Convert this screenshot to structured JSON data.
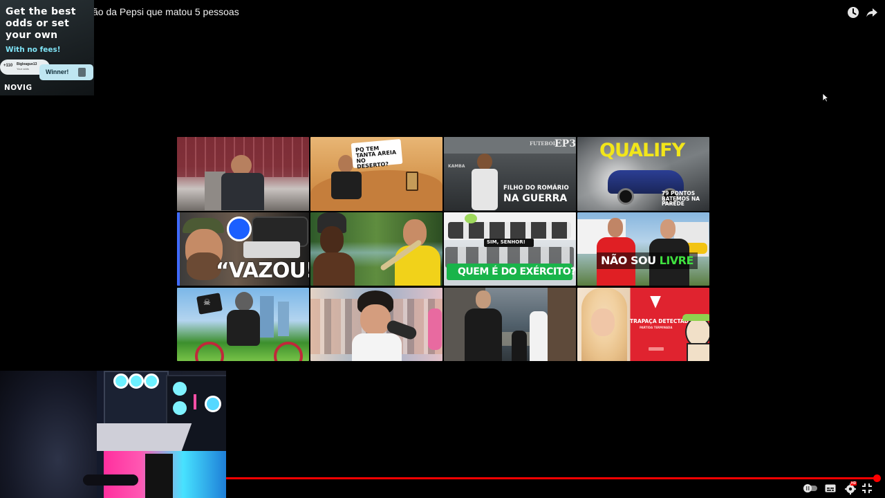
{
  "player": {
    "title": "ão da Pepsi que matou 5 pessoas",
    "icons": [
      "clock-icon",
      "share-icon"
    ],
    "progress_fraction": 1.0,
    "accent_color": "#ff0000"
  },
  "ad": {
    "headline": "Get the best odds or set your own",
    "subline": "With no fees!",
    "user_number": "+110",
    "user_name": "Bigleague13",
    "user_sub": "Your odds",
    "winner_label": "Winner!",
    "brand": "NOVIG"
  },
  "end_screen": {
    "thumbnails": [
      {
        "id": 1,
        "caption": ""
      },
      {
        "id": 2,
        "caption": "PQ TEM TANTA AREIA NO DESERTO?"
      },
      {
        "id": 3,
        "caption_top": "FUTEBOL",
        "caption_ep": "EP3",
        "caption_line1": "FILHO DO ROMÁRIO",
        "caption_line2": "NA GUERRA",
        "sign": "KAMBA"
      },
      {
        "id": 4,
        "caption": "QUALIFY",
        "sub_caption": "79 PONTOS BATEMOS NA PAREDE"
      },
      {
        "id": 5,
        "caption": "“VAZOU!”"
      },
      {
        "id": 6,
        "caption": ""
      },
      {
        "id": 7,
        "caption": "QUEM É DO EXÉRCITO?",
        "badge1": "SIM, SENHOR!"
      },
      {
        "id": 8,
        "caption_a": "NÃO SOU ",
        "caption_b": "LIVRE"
      },
      {
        "id": 9,
        "caption": ""
      },
      {
        "id": 10,
        "caption": ""
      },
      {
        "id": 11,
        "caption": ""
      },
      {
        "id": 12,
        "caption": "TRAPAÇA DETECTADA",
        "sub_caption": "PARTIDA TERMINADA"
      }
    ]
  },
  "controls": {
    "icons": [
      "autoplay-toggle-icon",
      "subtitles-icon",
      "settings-icon",
      "exit-fullscreen-icon"
    ],
    "settings_badge": "HD"
  }
}
